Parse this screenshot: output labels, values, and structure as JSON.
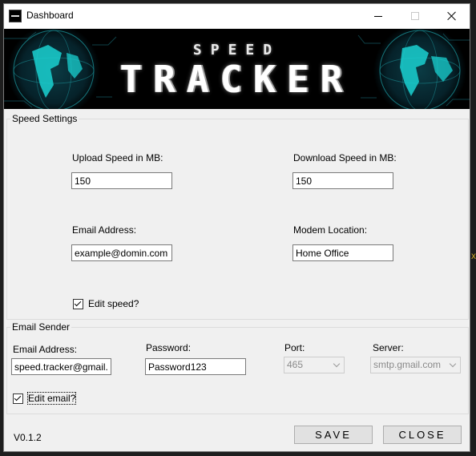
{
  "window": {
    "title": "Dashboard",
    "controls": {
      "minimize": "minimize",
      "maximize": "maximize",
      "close": "close"
    }
  },
  "banner": {
    "brand_top": "SPEED",
    "brand_main": "TRACKER",
    "globe_color": "#1ad1d1"
  },
  "speed_settings": {
    "legend": "Speed Settings",
    "upload_label": "Upload Speed in MB:",
    "upload_value": "150",
    "download_label": "Download Speed in MB:",
    "download_value": "150",
    "email_label": "Email Address:",
    "email_value": "example@domin.com",
    "modem_label": "Modem Location:",
    "modem_value": "Home Office",
    "edit_speed_label": "Edit speed?",
    "edit_speed_checked": true
  },
  "email_sender": {
    "legend": "Email Sender",
    "email_label": "Email Address:",
    "email_value": "speed.tracker@gmail.c",
    "password_label": "Password:",
    "password_value": "Password123",
    "port_label": "Port:",
    "port_value": "465",
    "server_label": "Server:",
    "server_value": "smtp.gmail.com",
    "edit_email_label": "Edit email?",
    "edit_email_checked": true
  },
  "footer": {
    "version": "V0.1.2",
    "save_label": "SAVE",
    "close_label": "CLOSE"
  },
  "colors": {
    "window_bg": "#f0f0f0",
    "banner_bg": "#000000",
    "desktop_bg": "#1e1e1e"
  }
}
